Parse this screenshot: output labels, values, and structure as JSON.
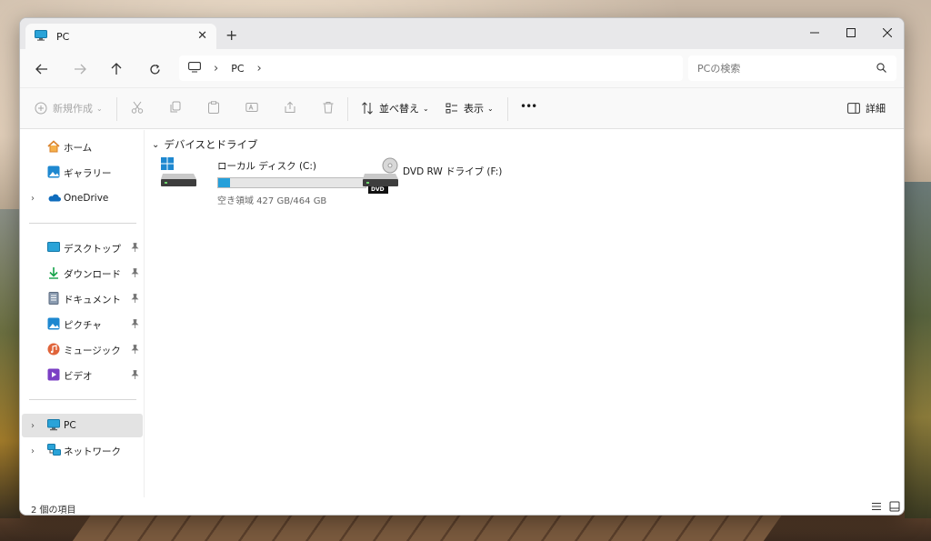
{
  "window": {
    "tab_title": "PC",
    "new_tab": "+"
  },
  "nav": {
    "breadcrumb": [
      "PC"
    ],
    "search_placeholder": "PCの検索"
  },
  "toolbar": {
    "new_label": "新規作成",
    "sort_label": "並べ替え",
    "view_label": "表示",
    "more_label": "•••",
    "details_label": "詳細"
  },
  "sidebar": {
    "quick": [
      {
        "label": "ホーム",
        "icon": "home-icon"
      },
      {
        "label": "ギャラリー",
        "icon": "gallery-icon"
      },
      {
        "label": "OneDrive",
        "icon": "cloud-icon"
      }
    ],
    "pinned": [
      {
        "label": "デスクトップ",
        "icon": "desktop-icon"
      },
      {
        "label": "ダウンロード",
        "icon": "download-icon"
      },
      {
        "label": "ドキュメント",
        "icon": "document-icon"
      },
      {
        "label": "ピクチャ",
        "icon": "pictures-icon"
      },
      {
        "label": "ミュージック",
        "icon": "music-icon"
      },
      {
        "label": "ビデオ",
        "icon": "video-icon"
      }
    ],
    "bottom": [
      {
        "label": "PC",
        "icon": "pc-icon",
        "selected": true
      },
      {
        "label": "ネットワーク",
        "icon": "network-icon"
      }
    ]
  },
  "content": {
    "section_title": "デバイスとドライブ",
    "drives": [
      {
        "name": "ローカル ディスク (C:)",
        "space": "空き領域 427 GB/464 GB",
        "used_fraction": 0.08,
        "icon": "hdd-windows-icon"
      },
      {
        "name": "DVD RW ドライブ (F:)",
        "icon": "dvd-drive-icon",
        "badge": "DVD"
      }
    ]
  },
  "status": {
    "item_count": "2 個の項目"
  },
  "colors": {
    "accent": "#26a0da",
    "selected_bg": "#e3e3e3",
    "titlebar_bg": "#e8e8ea"
  }
}
